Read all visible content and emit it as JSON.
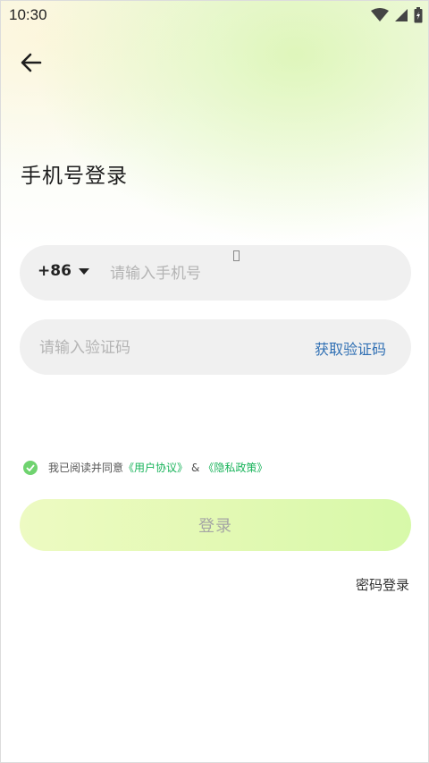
{
  "status_bar": {
    "time": "10:30"
  },
  "header": {
    "title": "手机号登录"
  },
  "phone": {
    "country_code": "+86",
    "placeholder": "请输入手机号"
  },
  "code": {
    "placeholder": "请输入验证码",
    "get_code_label": "获取验证码"
  },
  "agreement": {
    "prefix": "我已阅读并同意",
    "user_agreement": "《用户协议》",
    "ampersand": "&",
    "privacy_policy": "《隐私政策》"
  },
  "actions": {
    "login_label": "登录",
    "password_login_label": "密码登录"
  },
  "colors": {
    "link": "#18b35a",
    "get_code": "#2f6fb3",
    "check": "#6fd36f"
  },
  "icons": [
    "wifi-icon",
    "signal-icon",
    "battery-icon",
    "back-arrow-icon",
    "caret-down-icon",
    "check-circle-icon"
  ]
}
